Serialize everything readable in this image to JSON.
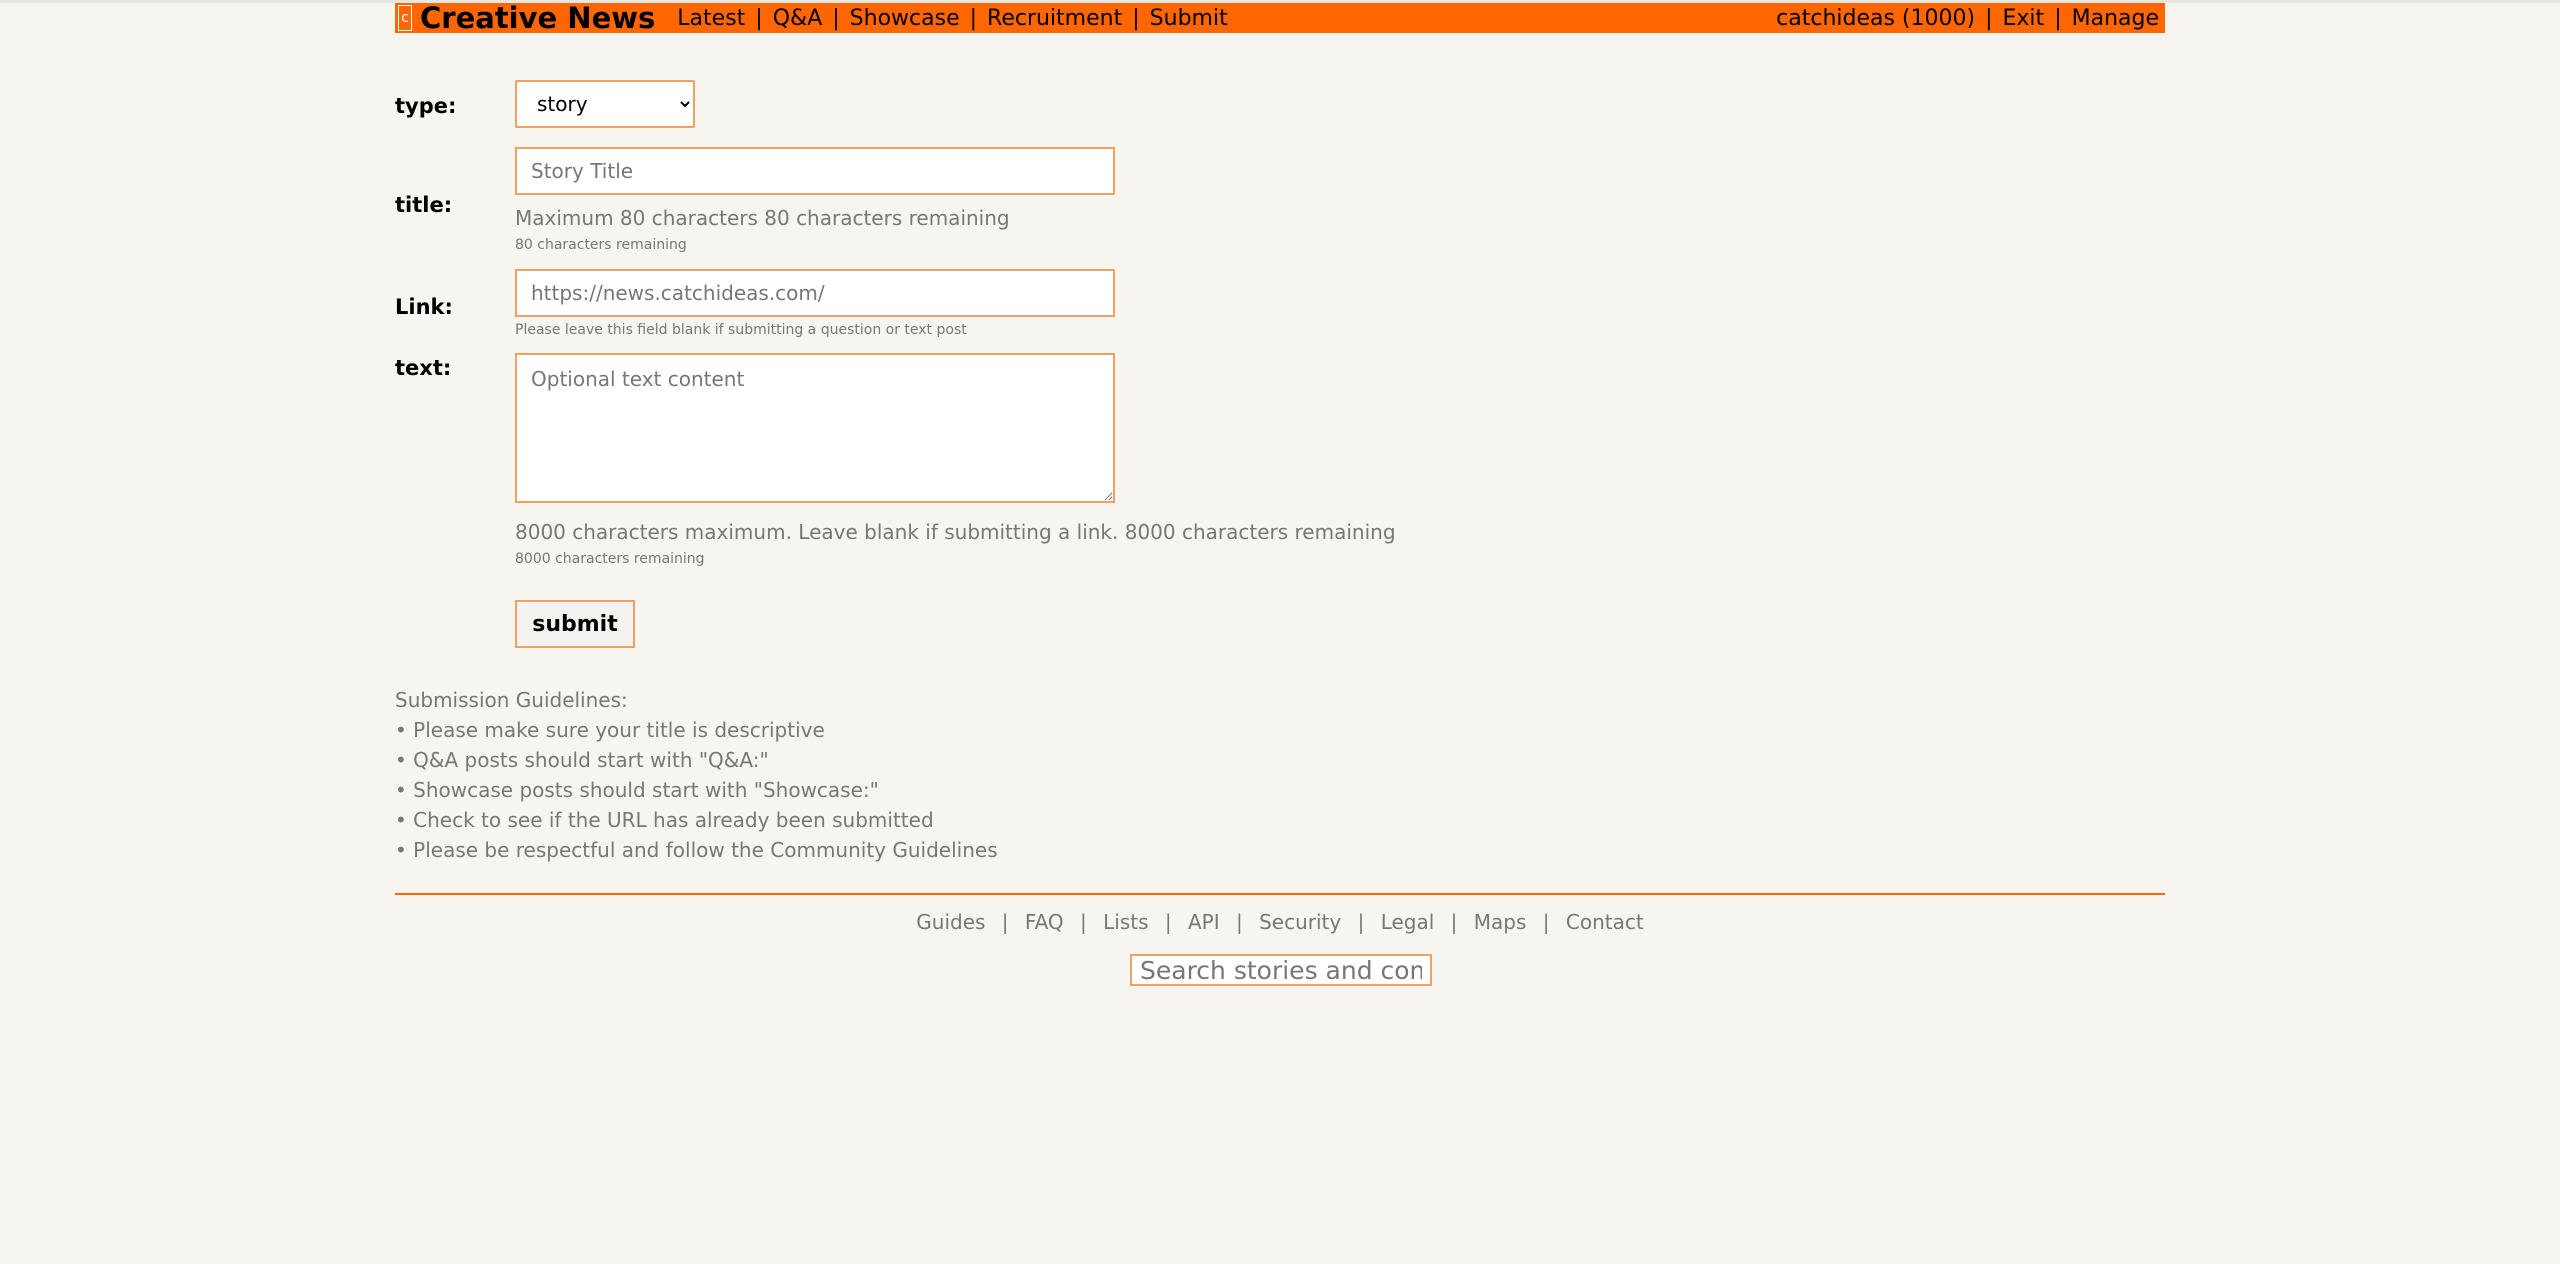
{
  "header": {
    "logo_letter": "c",
    "site_title": "Creative News",
    "nav": [
      "Latest",
      "Q&A",
      "Showcase",
      "Recruitment",
      "Submit"
    ],
    "user": "catchideas (1000)",
    "exit": "Exit",
    "manage": "Manage",
    "separator": "|"
  },
  "form": {
    "type_label": "type:",
    "type_value": "story",
    "title_label": "title:",
    "title_placeholder": "Story Title",
    "title_hint": "Maximum 80 characters 80 characters remaining",
    "title_counter": "80 characters remaining",
    "link_label": "Link:",
    "link_value": "https://news.catchideas.com/",
    "link_hint": "Please leave this field blank if submitting a question or text post",
    "text_label": "text:",
    "text_placeholder": "Optional text content",
    "text_hint": "8000 characters maximum. Leave blank if submitting a link. 8000 characters remaining",
    "text_counter": "8000 characters remaining",
    "submit_label": "submit"
  },
  "guidelines": {
    "title": "Submission Guidelines:",
    "items": [
      "• Please make sure your title is descriptive",
      "• Q&A posts should start with \"Q&A:\"",
      "• Showcase posts should start with \"Showcase:\"",
      "• Check to see if the URL has already been submitted",
      "• Please be respectful and follow the Community Guidelines"
    ]
  },
  "footer": {
    "links": [
      "Guides",
      "FAQ",
      "Lists",
      "API",
      "Security",
      "Legal",
      "Maps",
      "Contact"
    ],
    "search_placeholder": "Search stories and comments"
  },
  "colors": {
    "accent": "#ff6600",
    "background": "#f6f5ef",
    "muted_text": "#777777"
  }
}
